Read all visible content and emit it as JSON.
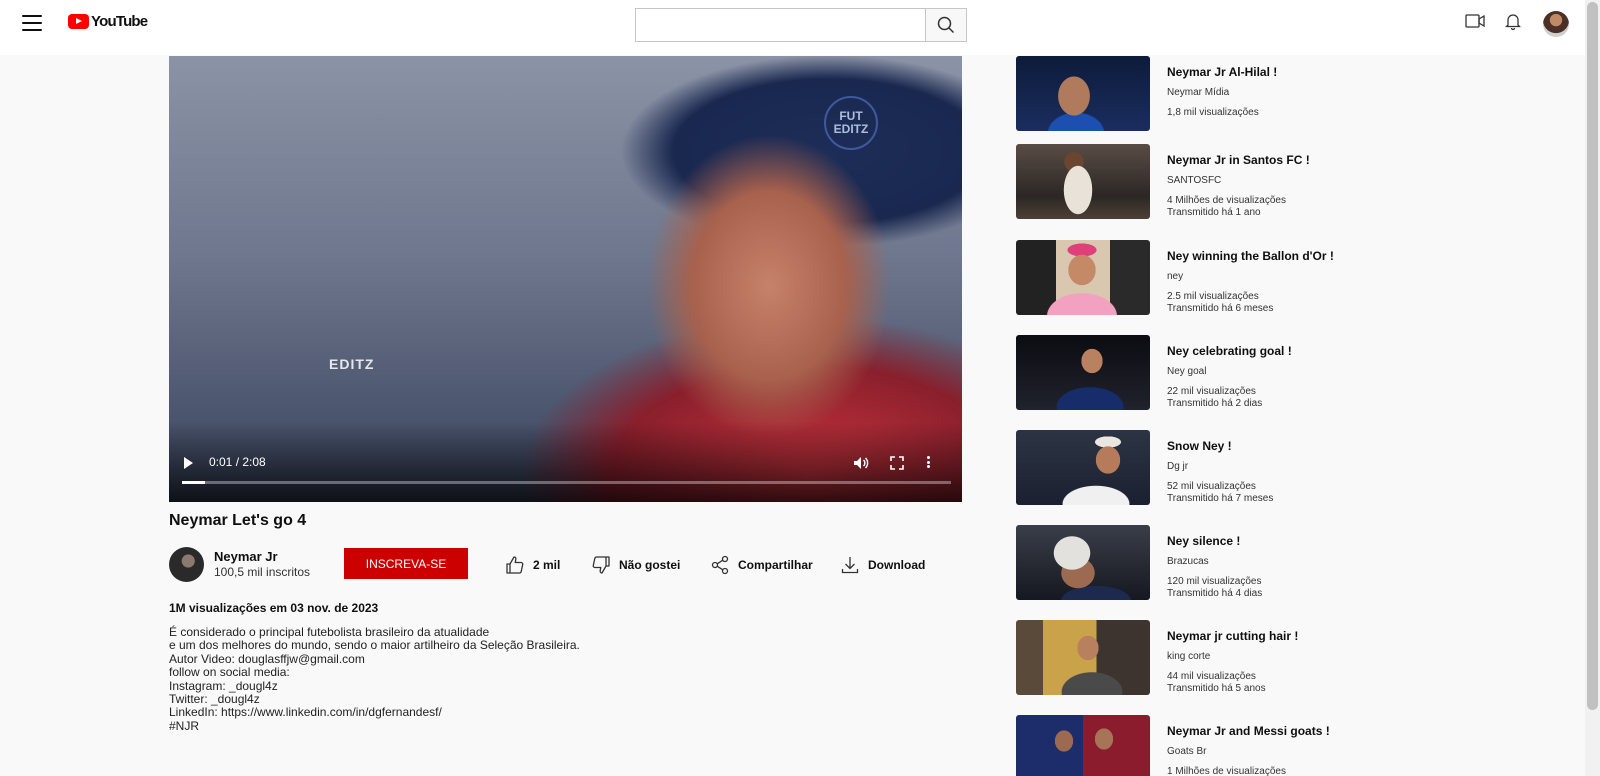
{
  "header": {
    "logo_text": "YouTube",
    "search_placeholder": "",
    "search_value": ""
  },
  "player": {
    "watermark_top": "FUT EDITZ",
    "watermark_mid": "EDITZ",
    "time": "0:01 / 2:08",
    "progress": 0.03
  },
  "video": {
    "title": "Neymar Let's go 4",
    "channel_name": "Neymar Jr",
    "subscribers": "100,5 mil inscritos",
    "subscribe_label": "INSCREVA-SE",
    "like_count": "2 mil",
    "dislike_label": "Não gostei",
    "share_label": "Compartilhar",
    "download_label": "Download",
    "views_date": "1M visualizações em 03 nov. de 2023",
    "description": [
      "É considerado o principal futebolista brasileiro da atualidade",
      "e um dos melhores do mundo, sendo o maior artilheiro da Seleção Brasileira.",
      "Autor Video: douglasffjw@gmail.com",
      "follow on social media:",
      "Instagram: _dougl4z",
      "Twitter: _dougl4z",
      "LinkedIn: https://www.linkedin.com/in/dgfernandesf/",
      "#NJR"
    ]
  },
  "recommendations": [
    {
      "title": "Neymar Jr Al-Hilal !",
      "channel": "Neymar Mídia",
      "views": "1,8 mil visualizações",
      "age": ""
    },
    {
      "title": "Neymar Jr in Santos FC !",
      "channel": "SANTOSFC",
      "views": "4 Milhões de visualizações",
      "age": "Transmitido há 1 ano"
    },
    {
      "title": "Ney winning the Ballon d'Or !",
      "channel": "ney",
      "views": "2.5 mil visualizações",
      "age": "Transmitido há 6 meses"
    },
    {
      "title": "Ney celebrating goal !",
      "channel": "Ney goal",
      "views": "22 mil visualizações",
      "age": "Transmitido há 2 dias"
    },
    {
      "title": "Snow Ney !",
      "channel": "Dg jr",
      "views": "52 mil visualizações",
      "age": "Transmitido há 7 meses"
    },
    {
      "title": "Ney silence !",
      "channel": "Brazucas",
      "views": "120 mil visualizações",
      "age": "Transmitido há 4 dias"
    },
    {
      "title": "Neymar jr cutting hair !",
      "channel": "king corte",
      "views": "44 mil visualizações",
      "age": "Transmitido há 5 anos"
    },
    {
      "title": "Neymar Jr and Messi goats !",
      "channel": "Goats Br",
      "views": "1 Milhões de visualizações",
      "age": ""
    }
  ],
  "colors": {
    "brand_red": "#ff0000",
    "subscribe_red": "#cc0000",
    "background": "#f9f9f9"
  }
}
